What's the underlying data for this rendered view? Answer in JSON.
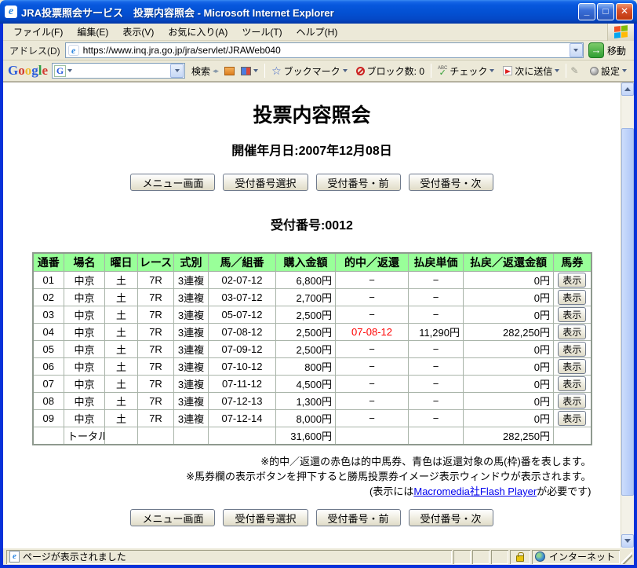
{
  "window": {
    "title": "JRA投票照会サービス　投票内容照会 - Microsoft Internet Explorer"
  },
  "menu": {
    "items": [
      "ファイル(F)",
      "編集(E)",
      "表示(V)",
      "お気に入り(A)",
      "ツール(T)",
      "ヘルプ(H)"
    ]
  },
  "address": {
    "label": "アドレス(D)",
    "url": "https://www.inq.jra.go.jp/jra/servlet/JRAWeb040",
    "go_label": "移動"
  },
  "google_toolbar": {
    "logo": "Google",
    "g_badge": "G",
    "search_label": "検索",
    "bookmarks_label": "ブックマーク",
    "block_label": "ブロック数: 0",
    "check_label": "チェック",
    "send_label": "次に送信",
    "settings_label": "設定"
  },
  "page": {
    "title": "投票内容照会",
    "date_line": "開催年月日:2007年12月08日",
    "receipt_number": "受付番号:0012",
    "nav_buttons": [
      "メニュー画面",
      "受付番号選択",
      "受付番号・前",
      "受付番号・次"
    ],
    "table": {
      "headers": [
        "通番",
        "場名",
        "曜日",
        "レース",
        "式別",
        "馬／組番",
        "購入金額",
        "的中／返還",
        "払戻単価",
        "払戻／返還金額",
        "馬券"
      ],
      "show_button_label": "表示",
      "rows": [
        {
          "no": "01",
          "place": "中京",
          "day": "土",
          "race": "7R",
          "type": "3連複",
          "numbers": "02-07-12",
          "amount": "6,800円",
          "hit": "−",
          "unit": "−",
          "payout": "0円",
          "hit_red": false
        },
        {
          "no": "02",
          "place": "中京",
          "day": "土",
          "race": "7R",
          "type": "3連複",
          "numbers": "03-07-12",
          "amount": "2,700円",
          "hit": "−",
          "unit": "−",
          "payout": "0円",
          "hit_red": false
        },
        {
          "no": "03",
          "place": "中京",
          "day": "土",
          "race": "7R",
          "type": "3連複",
          "numbers": "05-07-12",
          "amount": "2,500円",
          "hit": "−",
          "unit": "−",
          "payout": "0円",
          "hit_red": false
        },
        {
          "no": "04",
          "place": "中京",
          "day": "土",
          "race": "7R",
          "type": "3連複",
          "numbers": "07-08-12",
          "amount": "2,500円",
          "hit": "07-08-12",
          "unit": "11,290円",
          "payout": "282,250円",
          "hit_red": true
        },
        {
          "no": "05",
          "place": "中京",
          "day": "土",
          "race": "7R",
          "type": "3連複",
          "numbers": "07-09-12",
          "amount": "2,500円",
          "hit": "−",
          "unit": "−",
          "payout": "0円",
          "hit_red": false
        },
        {
          "no": "06",
          "place": "中京",
          "day": "土",
          "race": "7R",
          "type": "3連複",
          "numbers": "07-10-12",
          "amount": "800円",
          "hit": "−",
          "unit": "−",
          "payout": "0円",
          "hit_red": false
        },
        {
          "no": "07",
          "place": "中京",
          "day": "土",
          "race": "7R",
          "type": "3連複",
          "numbers": "07-11-12",
          "amount": "4,500円",
          "hit": "−",
          "unit": "−",
          "payout": "0円",
          "hit_red": false
        },
        {
          "no": "08",
          "place": "中京",
          "day": "土",
          "race": "7R",
          "type": "3連複",
          "numbers": "07-12-13",
          "amount": "1,300円",
          "hit": "−",
          "unit": "−",
          "payout": "0円",
          "hit_red": false
        },
        {
          "no": "09",
          "place": "中京",
          "day": "土",
          "race": "7R",
          "type": "3連複",
          "numbers": "07-12-14",
          "amount": "8,000円",
          "hit": "−",
          "unit": "−",
          "payout": "0円",
          "hit_red": false
        }
      ],
      "total": {
        "label": "トータル",
        "amount": "31,600円",
        "payout": "282,250円"
      }
    },
    "notes": {
      "line1": "※的中／返還の赤色は的中馬券、青色は返還対象の馬(枠)番を表します。",
      "line2": "※馬券欄の表示ボタンを押下すると勝馬投票券イメージ表示ウィンドウが表示されます。",
      "line3_prefix": "(表示には",
      "line3_link": "Macromedia社Flash Player",
      "line3_suffix": "が必要です)"
    }
  },
  "status_bar": {
    "text": "ページが表示されました",
    "zone": "インターネット"
  }
}
